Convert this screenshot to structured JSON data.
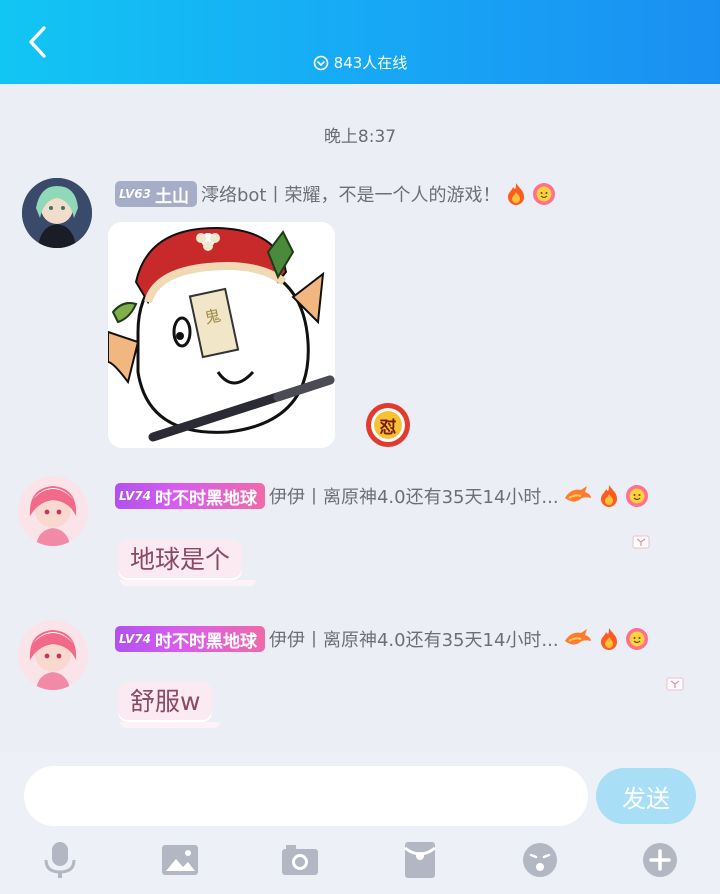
{
  "header": {
    "online_count": "843人在线"
  },
  "timestamp": "晚上8:37",
  "messages": [
    {
      "level": "LV63",
      "name": "土山",
      "info": "澪络bot丨荣耀，不是一个人的游戏！",
      "type": "sticker"
    },
    {
      "level": "LV74",
      "name": "时不时黑地球",
      "info": "伊伊丨离原神4.0还有35天14小时...",
      "text": "地球是个"
    },
    {
      "level": "LV74",
      "name": "时不时黑地球",
      "info": "伊伊丨离原神4.0还有35天14小时...",
      "text": "舒服w"
    }
  ],
  "composer": {
    "input_value": "",
    "send_label": "发送"
  },
  "badge_glyph": "怼",
  "icons": [
    "back-icon",
    "online-icon",
    "fire-icon",
    "flower-face-icon",
    "dragon-icon",
    "microphone-icon",
    "image-icon",
    "camera-icon",
    "red-packet-icon",
    "emoji-icon",
    "plus-icon"
  ],
  "colors": {
    "header_start": "#12c6f3",
    "header_end": "#1a8ff2",
    "send_button": "#a8dff6",
    "bubble": "#fbeaf2",
    "lv_grey": "#a6adc6",
    "lv_purple_start": "#b052ee",
    "lv_purple_end": "#f06aa8"
  }
}
